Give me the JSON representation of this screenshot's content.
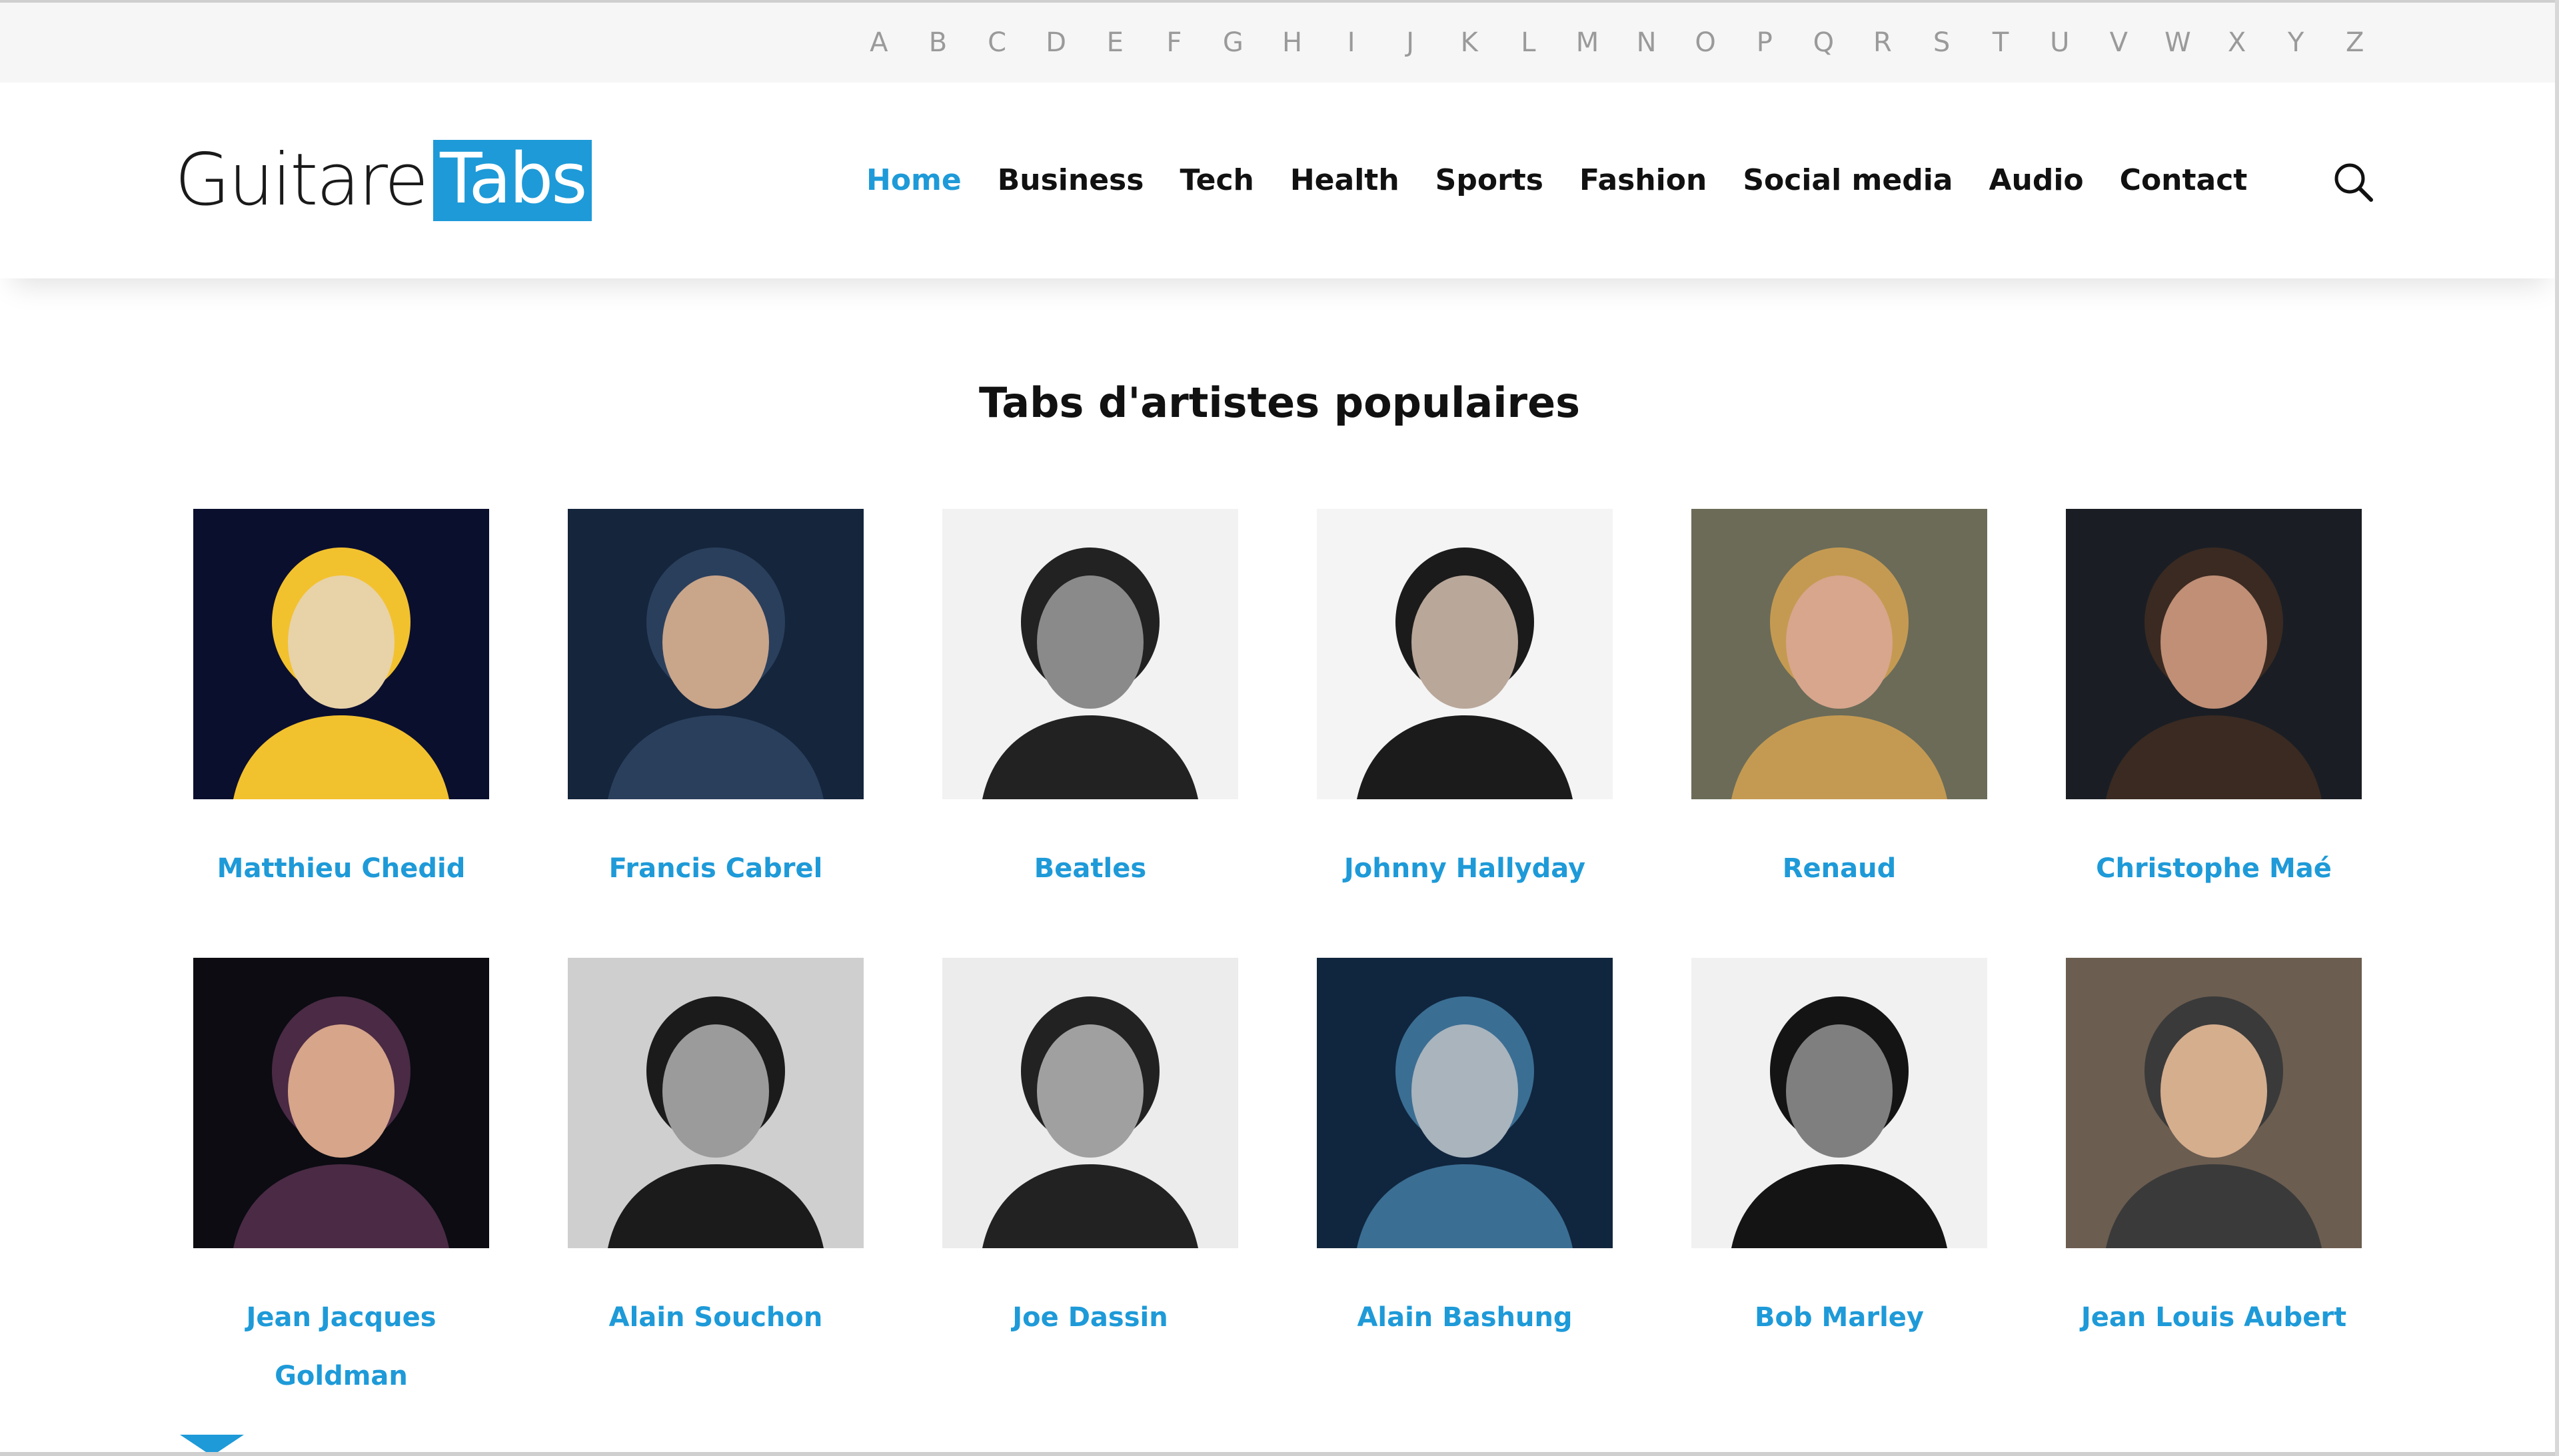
{
  "alphabet": [
    "A",
    "B",
    "C",
    "D",
    "E",
    "F",
    "G",
    "H",
    "I",
    "J",
    "K",
    "L",
    "M",
    "N",
    "O",
    "P",
    "Q",
    "R",
    "S",
    "T",
    "U",
    "V",
    "W",
    "X",
    "Y",
    "Z"
  ],
  "logo": {
    "part1": "Guitare",
    "part2": "Tabs"
  },
  "nav": {
    "items": [
      "Home",
      "Business",
      "Tech",
      "Health",
      "Sports",
      "Fashion",
      "Social media",
      "Audio",
      "Contact"
    ],
    "active": "Home"
  },
  "search": {
    "icon": "search-icon"
  },
  "main": {
    "title": "Tabs d'artistes populaires",
    "artists": [
      "Matthieu Chedid",
      "Francis Cabrel",
      "Beatles",
      "Johnny Hallyday",
      "Renaud",
      "Christophe Maé",
      "Jean Jacques Goldman",
      "Alain Souchon",
      "Joe Dassin",
      "Alain Bashung",
      "Bob Marley",
      "Jean Louis Aubert"
    ]
  },
  "colors": {
    "accent": "#1e9ad8",
    "text": "#111111",
    "alpha": "#9a9a9a",
    "alpha_bg": "#f6f6f6"
  }
}
